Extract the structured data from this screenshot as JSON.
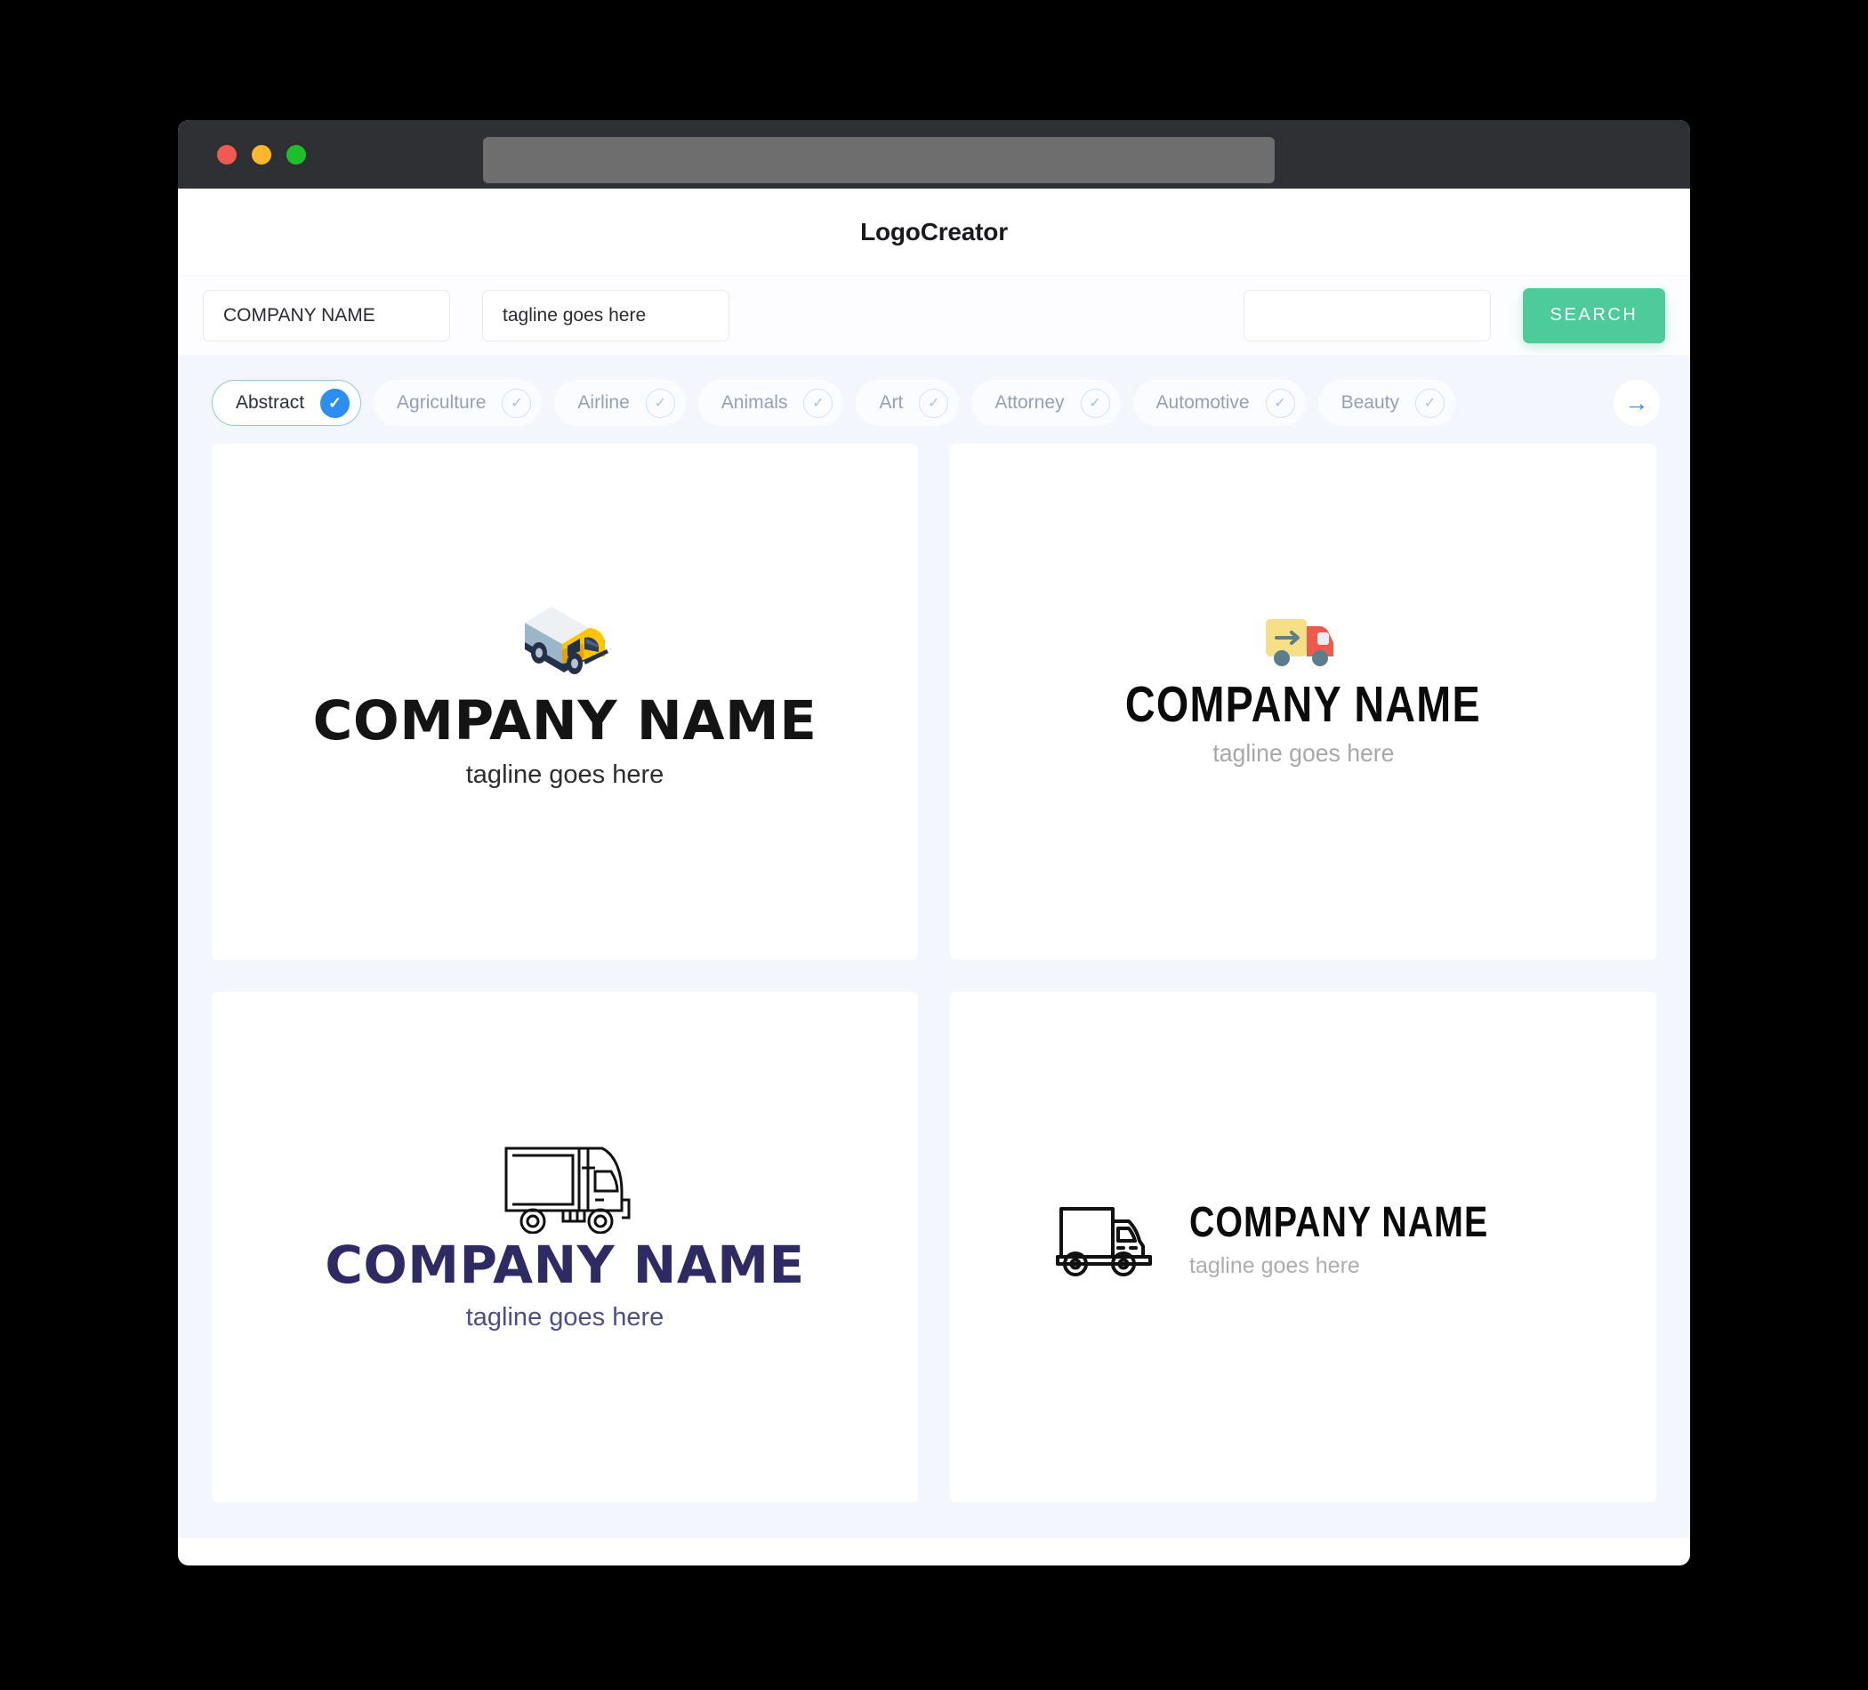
{
  "window": {
    "traffic_lights": [
      "close",
      "minimize",
      "maximize"
    ],
    "url_value": ""
  },
  "header": {
    "app_title": "LogoCreator"
  },
  "search": {
    "company_value": "COMPANY NAME",
    "company_placeholder": "COMPANY NAME",
    "tagline_value": "tagline goes here",
    "tagline_placeholder": "tagline goes here",
    "extra_value": "",
    "extra_placeholder": "",
    "button_label": "SEARCH",
    "button_color": "#4ecb9b"
  },
  "filters": {
    "next_arrow": "→",
    "check_glyph": "✓",
    "selected_color": "#2e8ef0",
    "chips": [
      {
        "label": "Abstract",
        "selected": true
      },
      {
        "label": "Agriculture",
        "selected": false
      },
      {
        "label": "Airline",
        "selected": false
      },
      {
        "label": "Animals",
        "selected": false
      },
      {
        "label": "Art",
        "selected": false
      },
      {
        "label": "Attorney",
        "selected": false
      },
      {
        "label": "Automotive",
        "selected": false
      },
      {
        "label": "Beauty",
        "selected": false
      }
    ]
  },
  "results": {
    "cards": [
      {
        "icon": "isometric-truck-icon",
        "company_name": "COMPANY NAME",
        "tagline": "tagline goes here",
        "name_color": "#141414",
        "tagline_color": "#2d2d2d"
      },
      {
        "icon": "flat-delivery-truck-icon",
        "company_name": "COMPANY NAME",
        "tagline": "tagline goes here",
        "name_color": "#0b0b0b",
        "tagline_color": "#a8a8a8"
      },
      {
        "icon": "outline-semi-truck-icon",
        "company_name": "COMPANY NAME",
        "tagline": "tagline goes here",
        "name_color": "#2e2a63",
        "tagline_color": "#4e4e86"
      },
      {
        "icon": "outline-box-truck-icon",
        "company_name": "COMPANY NAME",
        "tagline": "tagline goes here",
        "name_color": "#0b0b0b",
        "tagline_color": "#adadad"
      }
    ]
  }
}
